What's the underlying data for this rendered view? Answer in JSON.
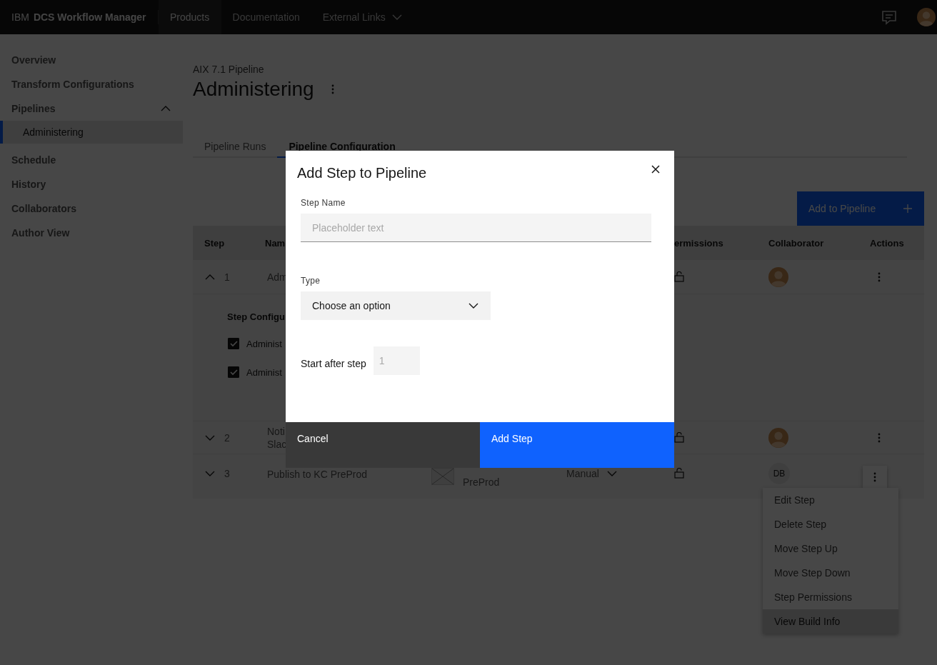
{
  "header": {
    "brand_prefix": "IBM",
    "brand_name": "DCS Workflow Manager",
    "nav": [
      {
        "label": "Products",
        "selected": true,
        "has_menu": false
      },
      {
        "label": "Documentation",
        "selected": false,
        "has_menu": false
      },
      {
        "label": "External Links",
        "selected": false,
        "has_menu": true
      }
    ]
  },
  "sidebar": {
    "items": [
      {
        "label": "Overview",
        "selected": false
      },
      {
        "label": "Transform Configurations",
        "selected": false
      },
      {
        "label": "Pipelines",
        "selected": false,
        "expanded": true,
        "children": [
          {
            "label": "Administering",
            "selected": true
          }
        ]
      },
      {
        "label": "Schedule",
        "selected": false
      },
      {
        "label": "History",
        "selected": false
      },
      {
        "label": "Collaborators",
        "selected": false
      },
      {
        "label": "Author View",
        "selected": false
      }
    ]
  },
  "page": {
    "breadcrumb": "AIX 7.1 Pipeline",
    "title": "Administering"
  },
  "tabs": [
    {
      "label": "Pipeline Runs",
      "selected": false
    },
    {
      "label": "Pipeline Configuration",
      "selected": true
    }
  ],
  "add_button": {
    "label": "Add to Pipeline"
  },
  "table": {
    "columns": [
      "Step",
      "Nam",
      "ermissions",
      "Collaborator",
      "Actions"
    ],
    "rows": [
      {
        "step": "1",
        "expanded": true,
        "name": [
          "Adm"
        ],
        "collaborator": {
          "kind": "avatar"
        },
        "detail_heading": "Step Configu",
        "options": [
          {
            "label": "Administ",
            "checked": true
          },
          {
            "label": "Administ",
            "checked": true
          }
        ]
      },
      {
        "step": "2",
        "expanded": false,
        "name": [
          "Noti",
          "Slac"
        ],
        "collaborator": {
          "kind": "avatar"
        }
      },
      {
        "step": "3",
        "expanded": false,
        "name": [
          "Publish to KC PreProd"
        ],
        "build": [
          "PreProd"
        ],
        "trigger": "Manual",
        "collaborator": {
          "kind": "initials",
          "text": "DB"
        }
      }
    ]
  },
  "menu": {
    "items": [
      {
        "label": "Edit Step",
        "selected": false
      },
      {
        "label": "Delete Step",
        "selected": false
      },
      {
        "label": "Move Step Up",
        "selected": false
      },
      {
        "label": "Move Step Down",
        "selected": false
      },
      {
        "label": "Step Permissions",
        "selected": false
      },
      {
        "label": "View Build Info",
        "selected": true
      }
    ]
  },
  "modal": {
    "title": "Add Step to Pipeline",
    "step_name": {
      "label": "Step Name",
      "placeholder": "Placeholder text"
    },
    "type": {
      "label": "Type",
      "value": "Choose an option"
    },
    "start_after": {
      "label": "Start after step",
      "placeholder": "1"
    },
    "buttons": [
      {
        "label": "Cancel",
        "kind": "secondary"
      },
      {
        "label": "Add Step",
        "kind": "primary"
      }
    ]
  }
}
